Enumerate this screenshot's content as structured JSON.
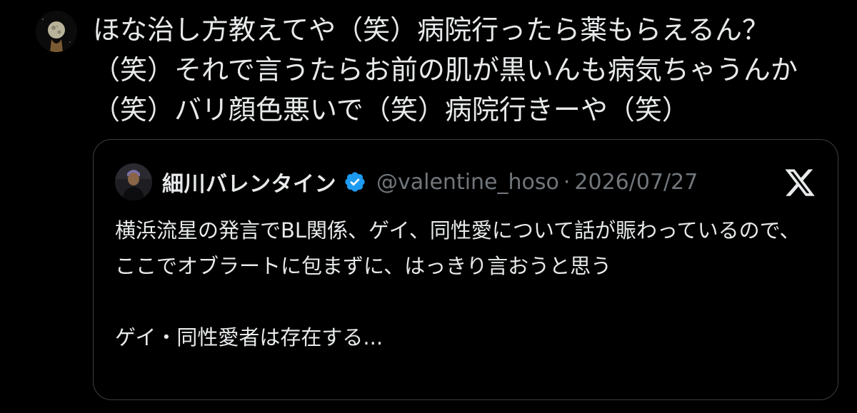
{
  "post": {
    "avatar_icon": "moon-avatar-icon",
    "text": "ほな治し方教えてや（笑）病院行ったら薬もらえるん？（笑）それで言うたらお前の肌が黒いんも病気ちゃうんか（笑）バリ顔色悪いで（笑）病院行きーや（笑）"
  },
  "quote": {
    "avatar_icon": "user-avatar-icon",
    "name": "細川バレンタイン",
    "verified_icon": "verified-badge-icon",
    "handle": "@valentine_hoso",
    "separator": "·",
    "date": "2026/07/27",
    "platform_icon": "x-logo-icon",
    "text": "横浜流星の発言でBL関係、ゲイ、同性愛について話が賑わっているので、ここでオブラートに包まずに、はっきり言おうと思う\n\nゲイ・同性愛者は存在する..."
  },
  "colors": {
    "background": "#000000",
    "text": "#e7e9ea",
    "muted": "#71767b",
    "border": "#3a3f44",
    "verified": "#1d9bf0"
  }
}
